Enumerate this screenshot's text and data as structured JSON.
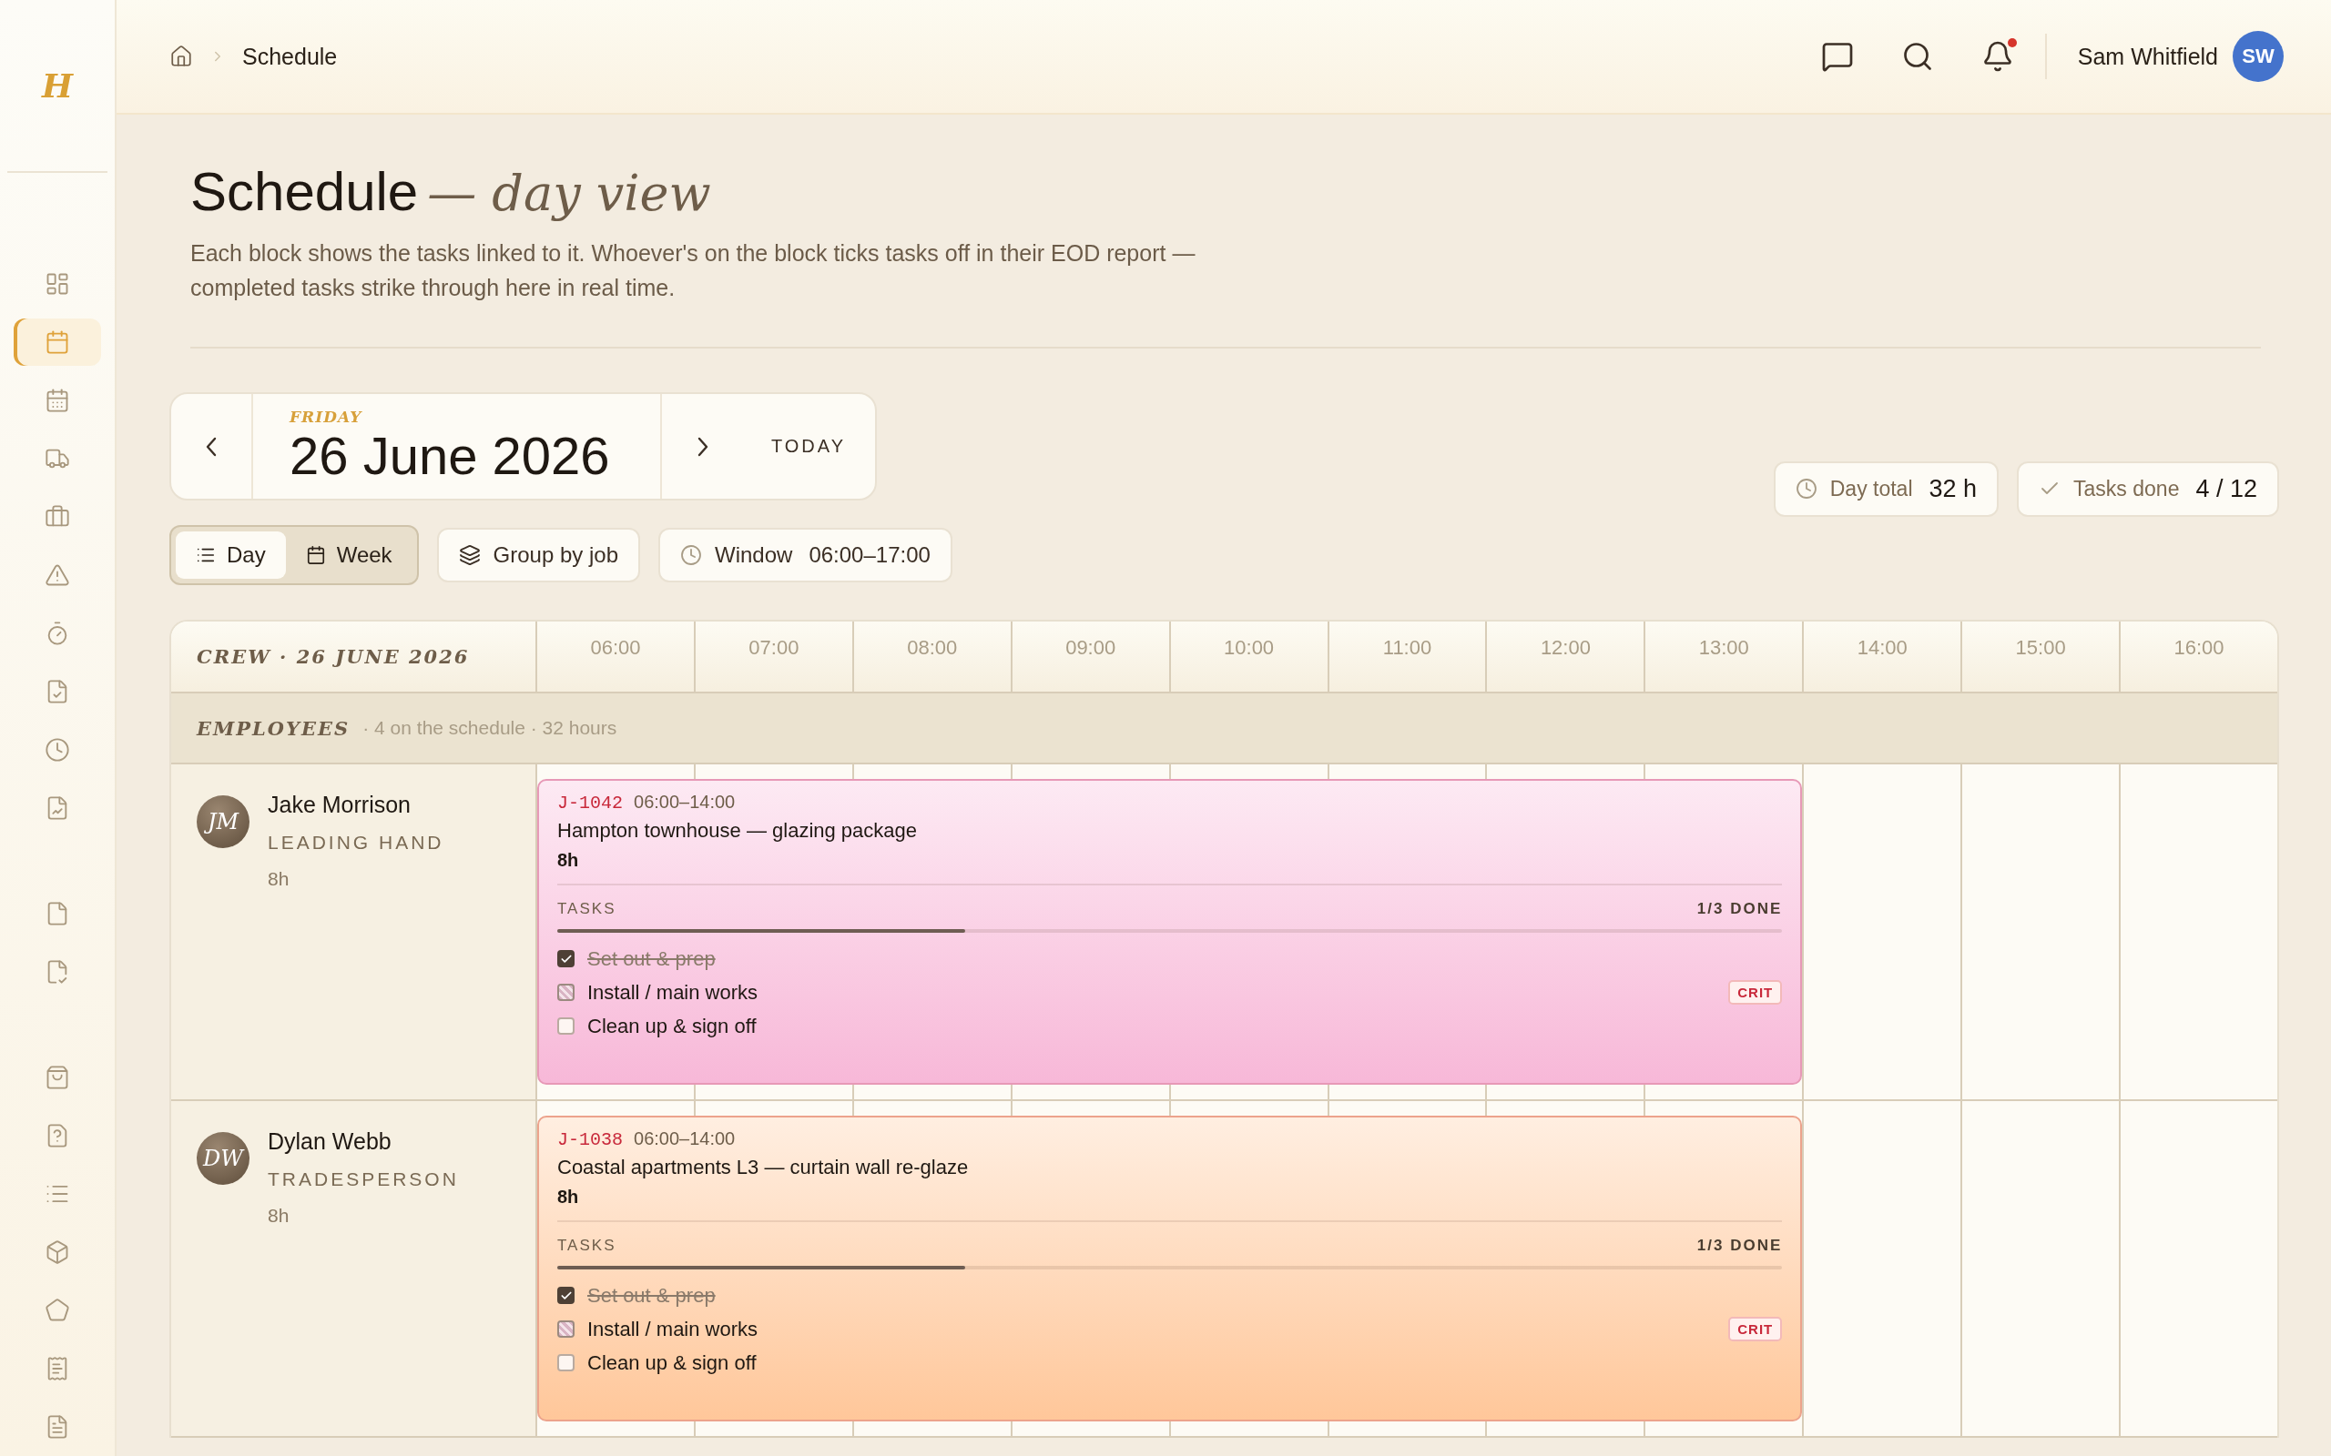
{
  "sidebar": {
    "logo": "H",
    "sections": [
      {
        "items": [
          {
            "selected": false
          },
          {
            "selected": true
          },
          {
            "selected": false
          },
          {
            "selected": false
          },
          {
            "selected": false
          },
          {
            "selected": false
          },
          {
            "selected": false
          },
          {
            "selected": false
          },
          {
            "selected": false
          },
          {
            "selected": false
          }
        ]
      },
      {
        "items": [
          {
            "selected": false
          },
          {
            "selected": false
          }
        ]
      },
      {
        "items": [
          {
            "selected": false
          },
          {
            "selected": false
          },
          {
            "selected": false
          },
          {
            "selected": false
          },
          {
            "selected": false
          },
          {
            "selected": false
          },
          {
            "selected": false
          }
        ]
      }
    ]
  },
  "header": {
    "breadcrumb": "Schedule",
    "notifications_unread": true,
    "user": {
      "name": "Sam Whitfield",
      "initials": "SW"
    }
  },
  "page": {
    "title": "Schedule",
    "title_suffix": "— day view",
    "description": "Each block shows the tasks linked to it. Whoever's on the block ticks tasks off in their EOD report — completed tasks strike through here in real time."
  },
  "date_nav": {
    "weekday": "FRIDAY",
    "date": "26 June 2026",
    "today": "TODAY"
  },
  "view_toggle": [
    {
      "label": "Day",
      "selected": true
    },
    {
      "label": "Week",
      "selected": false
    }
  ],
  "group_button": "Group by job",
  "window_button": {
    "label": "Window",
    "value": "06:00–17:00"
  },
  "stats": [
    {
      "kind": "clock",
      "label": "Day total",
      "value": "32 h"
    },
    {
      "kind": "check",
      "label": "Tasks done",
      "value": "4 / 12"
    }
  ],
  "grid": {
    "crew_header": "CREW · 26 JUNE 2026",
    "hours": [
      "06:00",
      "07:00",
      "08:00",
      "09:00",
      "10:00",
      "11:00",
      "12:00",
      "13:00",
      "14:00",
      "15:00",
      "16:00"
    ],
    "group": {
      "label": "EMPLOYEES",
      "summary": "· 4 on the schedule · 32 hours"
    },
    "rows": [
      {
        "name": "Jake Morrison",
        "initials": "JM",
        "role": "LEADING HAND",
        "hours": "8h",
        "block": {
          "color": "#f7b8d8",
          "job": "J-1042",
          "time": "06:00–14:00",
          "title": "Hampton townhouse — glazing package",
          "hours": "8h",
          "tasks_label": "TASKS",
          "done_label": "1/3 DONE",
          "level": 0.333,
          "tasks": [
            {
              "kind": "done",
              "label": "Set out & prep"
            },
            {
              "kind": "partial",
              "label": "Install / main works",
              "badge": "CRIT"
            },
            {
              "kind": "open",
              "label": "Clean up & sign off"
            }
          ]
        }
      },
      {
        "name": "Dylan Webb",
        "initials": "DW",
        "role": "TRADESPERSON",
        "hours": "8h",
        "block": {
          "color": "#ffc79a",
          "job": "J-1038",
          "time": "06:00–14:00",
          "title": "Coastal apartments L3 — curtain wall re-glaze",
          "hours": "8h",
          "tasks_label": "TASKS",
          "done_label": "1/3 DONE",
          "level": 0.333,
          "tasks": [
            {
              "kind": "done",
              "label": "Set out & prep"
            },
            {
              "kind": "partial",
              "label": "Install / main works",
              "badge": "CRIT"
            },
            {
              "kind": "open",
              "label": "Clean up & sign off"
            }
          ]
        }
      }
    ]
  }
}
